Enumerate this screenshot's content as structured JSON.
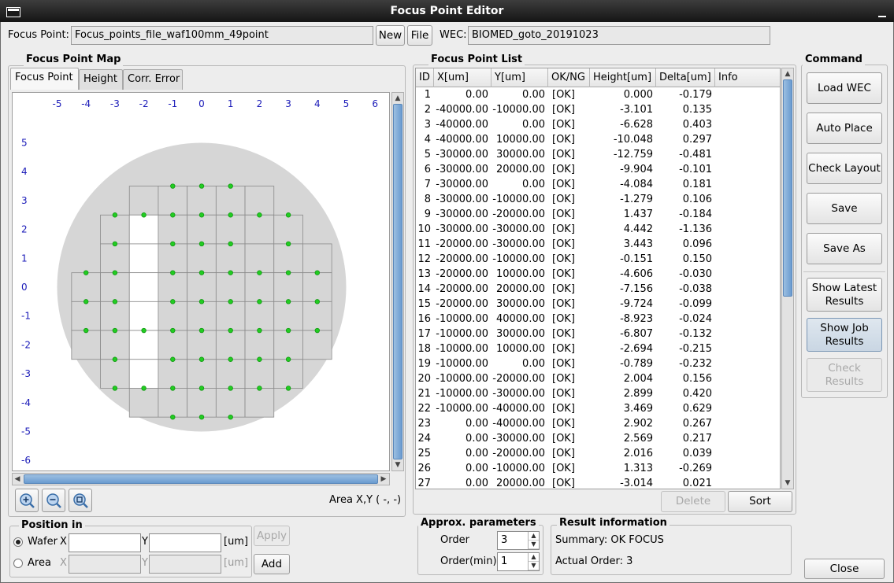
{
  "window": {
    "title": "Focus Point Editor"
  },
  "top": {
    "focus_point_label": "Focus Point:",
    "focus_point_value": "Focus_points_file_waf100mm_49point",
    "new_label": "New",
    "file_label": "File",
    "wec_label": "WEC:",
    "wec_value": "BIOMED_goto_20191023"
  },
  "map_panel": {
    "title": "Focus Point Map",
    "tabs": [
      "Focus Point",
      "Height",
      "Corr. Error"
    ],
    "selected_tab": "Focus Point",
    "x_ticks": [
      "-5",
      "-4",
      "-3",
      "-2",
      "-1",
      "0",
      "1",
      "2",
      "3",
      "4",
      "5",
      "6"
    ],
    "y_ticks": [
      "5",
      "4",
      "3",
      "2",
      "1",
      "0",
      "-1",
      "-2",
      "-3",
      "-4",
      "-5",
      "-6"
    ],
    "area_readout": "Area X,Y ( -, -)",
    "zoom_buttons": [
      "zoom-in-icon",
      "zoom-out-icon",
      "zoom-fit-icon"
    ],
    "colors": {
      "wafer": "#d6d6d6",
      "point": "#22cc22",
      "tick": "#1a1ab8",
      "highlight": "#ffffff"
    }
  },
  "position": {
    "title": "Position in",
    "wafer_label": "Wafer",
    "area_label": "Area",
    "x_label": "X",
    "y_label": "Y",
    "unit": "[um]",
    "apply_label": "Apply",
    "add_label": "Add",
    "wafer_x": "",
    "wafer_y": "",
    "area_x": "",
    "area_y": ""
  },
  "list_panel": {
    "title": "Focus Point List",
    "columns": [
      "ID",
      "X[um]",
      "Y[um]",
      "OK/NG",
      "Height[um]",
      "Delta[um]",
      "Info"
    ],
    "rows": [
      [
        "1",
        "0.00",
        "0.00",
        "[OK]",
        "0.000",
        "-0.179",
        ""
      ],
      [
        "2",
        "-40000.00",
        "-10000.00",
        "[OK]",
        "-3.101",
        "0.135",
        ""
      ],
      [
        "3",
        "-40000.00",
        "0.00",
        "[OK]",
        "-6.628",
        "0.403",
        ""
      ],
      [
        "4",
        "-40000.00",
        "10000.00",
        "[OK]",
        "-10.048",
        "0.297",
        ""
      ],
      [
        "5",
        "-30000.00",
        "30000.00",
        "[OK]",
        "-12.759",
        "-0.481",
        ""
      ],
      [
        "6",
        "-30000.00",
        "20000.00",
        "[OK]",
        "-9.904",
        "-0.101",
        ""
      ],
      [
        "7",
        "-30000.00",
        "0.00",
        "[OK]",
        "-4.084",
        "0.181",
        ""
      ],
      [
        "8",
        "-30000.00",
        "-10000.00",
        "[OK]",
        "-1.279",
        "0.106",
        ""
      ],
      [
        "9",
        "-30000.00",
        "-20000.00",
        "[OK]",
        "1.437",
        "-0.184",
        ""
      ],
      [
        "10",
        "-30000.00",
        "-30000.00",
        "[OK]",
        "4.442",
        "-1.136",
        ""
      ],
      [
        "11",
        "-20000.00",
        "-30000.00",
        "[OK]",
        "3.443",
        "0.096",
        ""
      ],
      [
        "12",
        "-20000.00",
        "-10000.00",
        "[OK]",
        "-0.151",
        "0.150",
        ""
      ],
      [
        "13",
        "-20000.00",
        "10000.00",
        "[OK]",
        "-4.606",
        "-0.030",
        ""
      ],
      [
        "14",
        "-20000.00",
        "20000.00",
        "[OK]",
        "-7.156",
        "-0.038",
        ""
      ],
      [
        "15",
        "-20000.00",
        "30000.00",
        "[OK]",
        "-9.724",
        "-0.099",
        ""
      ],
      [
        "16",
        "-10000.00",
        "40000.00",
        "[OK]",
        "-8.923",
        "-0.024",
        ""
      ],
      [
        "17",
        "-10000.00",
        "30000.00",
        "[OK]",
        "-6.807",
        "-0.132",
        ""
      ],
      [
        "18",
        "-10000.00",
        "10000.00",
        "[OK]",
        "-2.694",
        "-0.215",
        ""
      ],
      [
        "19",
        "-10000.00",
        "0.00",
        "[OK]",
        "-0.789",
        "-0.232",
        ""
      ],
      [
        "20",
        "-10000.00",
        "-20000.00",
        "[OK]",
        "2.004",
        "0.156",
        ""
      ],
      [
        "21",
        "-10000.00",
        "-30000.00",
        "[OK]",
        "2.899",
        "0.420",
        ""
      ],
      [
        "22",
        "-10000.00",
        "-40000.00",
        "[OK]",
        "3.469",
        "0.629",
        ""
      ],
      [
        "23",
        "0.00",
        "-40000.00",
        "[OK]",
        "2.902",
        "0.267",
        ""
      ],
      [
        "24",
        "0.00",
        "-30000.00",
        "[OK]",
        "2.569",
        "0.217",
        ""
      ],
      [
        "25",
        "0.00",
        "-20000.00",
        "[OK]",
        "2.016",
        "0.039",
        ""
      ],
      [
        "26",
        "0.00",
        "-10000.00",
        "[OK]",
        "1.313",
        "-0.269",
        ""
      ],
      [
        "27",
        "0.00",
        "20000.00",
        "[OK]",
        "-3.014",
        "0.021",
        ""
      ]
    ],
    "delete_label": "Delete",
    "sort_label": "Sort"
  },
  "approx": {
    "title": "Approx. parameters",
    "order_label": "Order",
    "order_value": "3",
    "order_min_label": "Order(min)",
    "order_min_value": "1"
  },
  "result": {
    "title": "Result information",
    "summary": "Summary: OK FOCUS",
    "actual_order": "Actual Order: 3"
  },
  "command": {
    "title": "Command",
    "load_wec": "Load WEC",
    "auto_place": "Auto Place",
    "check_layout": "Check Layout",
    "save": "Save",
    "save_as": "Save As",
    "show_latest": "Show Latest Results",
    "show_job": "Show Job Results",
    "check_results": "Check Results",
    "close": "Close"
  }
}
